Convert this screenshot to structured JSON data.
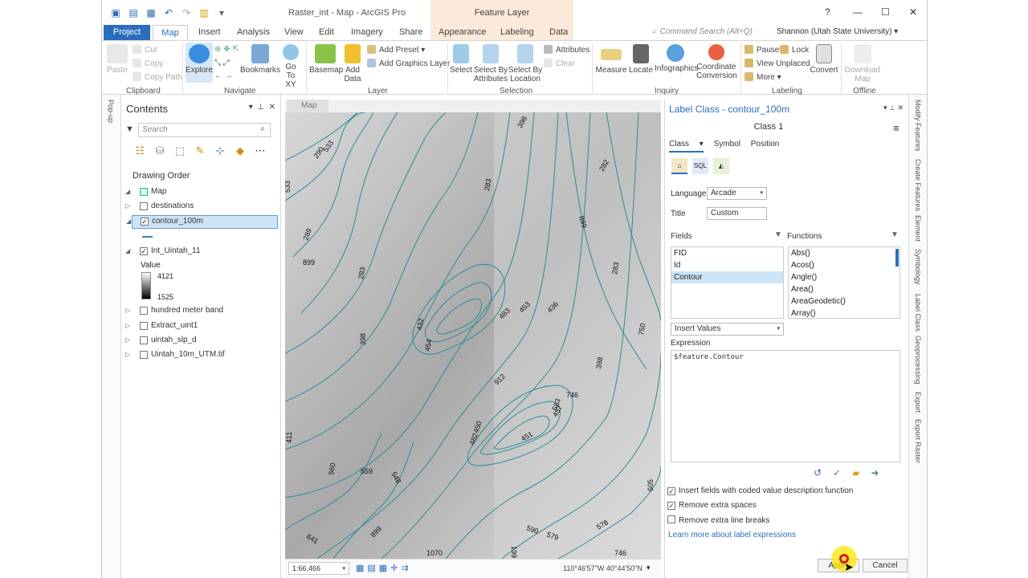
{
  "window": {
    "title": "Raster_int - Map - ArcGIS Pro",
    "contextual_tab_group": "Feature Layer",
    "help": "?",
    "minimize": "—",
    "maximize": "☐",
    "close": "✕"
  },
  "tabs": [
    "Project",
    "Map",
    "Insert",
    "Analysis",
    "View",
    "Edit",
    "Imagery",
    "Share",
    "Appearance",
    "Labeling",
    "Data"
  ],
  "command_search": "Command Search (Alt+Q)",
  "user": "Shannon (Utah State University) ▾",
  "ribbon": {
    "clipboard": {
      "paste": "Paste",
      "cut": "Cut",
      "copy": "Copy",
      "copy_path": "Copy Path",
      "label": "Clipboard"
    },
    "navigate": {
      "explore": "Explore",
      "bookmarks": "Bookmarks",
      "goto": "Go\nTo XY",
      "label": "Navigate"
    },
    "layer": {
      "basemap": "Basemap",
      "add_data": "Add\nData",
      "add_preset": "Add Preset",
      "add_graphics": "Add Graphics Layer",
      "label": "Layer"
    },
    "selection": {
      "select": "Select",
      "by_attributes": "Select By\nAttributes",
      "by_location": "Select By\nLocation",
      "attributes": "Attributes",
      "clear": "Clear",
      "label": "Selection"
    },
    "inquiry": {
      "measure": "Measure",
      "locate": "Locate",
      "infographics": "Infographics",
      "coord": "Coordinate\nConversion",
      "label": "Inquiry"
    },
    "labeling": {
      "pause": "Pause",
      "lock": "Lock",
      "view_unplaced": "View Unplaced",
      "more": "More",
      "convert": "Convert",
      "label": "Labeling"
    },
    "offline": {
      "download": "Download\nMap",
      "label": "Offline"
    }
  },
  "left_dock_label": "Pop-up",
  "contents": {
    "title": "Contents",
    "search_placeholder": "Search",
    "drawing_order": "Drawing Order",
    "layers": [
      {
        "name": "Map",
        "checked": null,
        "expanded": true
      },
      {
        "name": "destinations",
        "checked": false
      },
      {
        "name": "contour_100m",
        "checked": true,
        "selected": true
      },
      {
        "name": "Int_Uintah_11",
        "checked": true
      },
      {
        "name": "hundred meter band",
        "checked": false
      },
      {
        "name": "Extract_uint1",
        "checked": false
      },
      {
        "name": "uintah_slp_d",
        "checked": false
      },
      {
        "name": "Uintah_10m_UTM.tif",
        "checked": false
      }
    ],
    "legend": {
      "title": "Value",
      "high": "4121",
      "low": "1525"
    }
  },
  "map": {
    "tab_label": "Map",
    "scale": "1:66,466",
    "coords": "110°46'57\"W 40°44'50\"N",
    "contour_labels": [
      "290",
      "533",
      "533",
      "398",
      "282",
      "283",
      "899",
      "289",
      "899",
      "283",
      "283",
      "398",
      "432",
      "454",
      "483",
      "453",
      "436",
      "398",
      "750",
      "912",
      "746",
      "457",
      "583",
      "450",
      "482",
      "451",
      "411",
      "560",
      "559",
      "548",
      "641",
      "899",
      "590",
      "579",
      "578",
      "746",
      "605",
      "1070",
      "199"
    ]
  },
  "label_class": {
    "title": "Label Class - contour_100m",
    "class_name": "Class 1",
    "tabs": [
      "Class",
      "Symbol",
      "Position"
    ],
    "language_label": "Language",
    "language": "Arcade",
    "title_label": "Title",
    "title_value": "Custom",
    "fields_label": "Fields",
    "functions_label": "Functions",
    "fields": [
      "FID",
      "Id",
      "Contour"
    ],
    "functions": [
      "Abs()",
      "Acos()",
      "Angle()",
      "Area()",
      "AreaGeodetic()",
      "Array()"
    ],
    "insert_values": "Insert Values",
    "expression_label": "Expression",
    "expression": "$feature.Contour",
    "options": [
      {
        "label": "Insert fields with coded value description function",
        "checked": true
      },
      {
        "label": "Remove extra spaces",
        "checked": true
      },
      {
        "label": "Remove extra line breaks",
        "checked": false
      }
    ],
    "learn_more": "Learn more about label expressions",
    "apply": "Apply",
    "cancel": "Cancel"
  },
  "right_dock": [
    "Modify Features",
    "Create Features",
    "Element",
    "Symbology",
    "Label Class",
    "Geoprocessing",
    "Export",
    "Export Raster"
  ],
  "colors": {
    "accent": "#2a6ebb",
    "contour": "#2a8c9a",
    "selection": "#cde4f7"
  }
}
